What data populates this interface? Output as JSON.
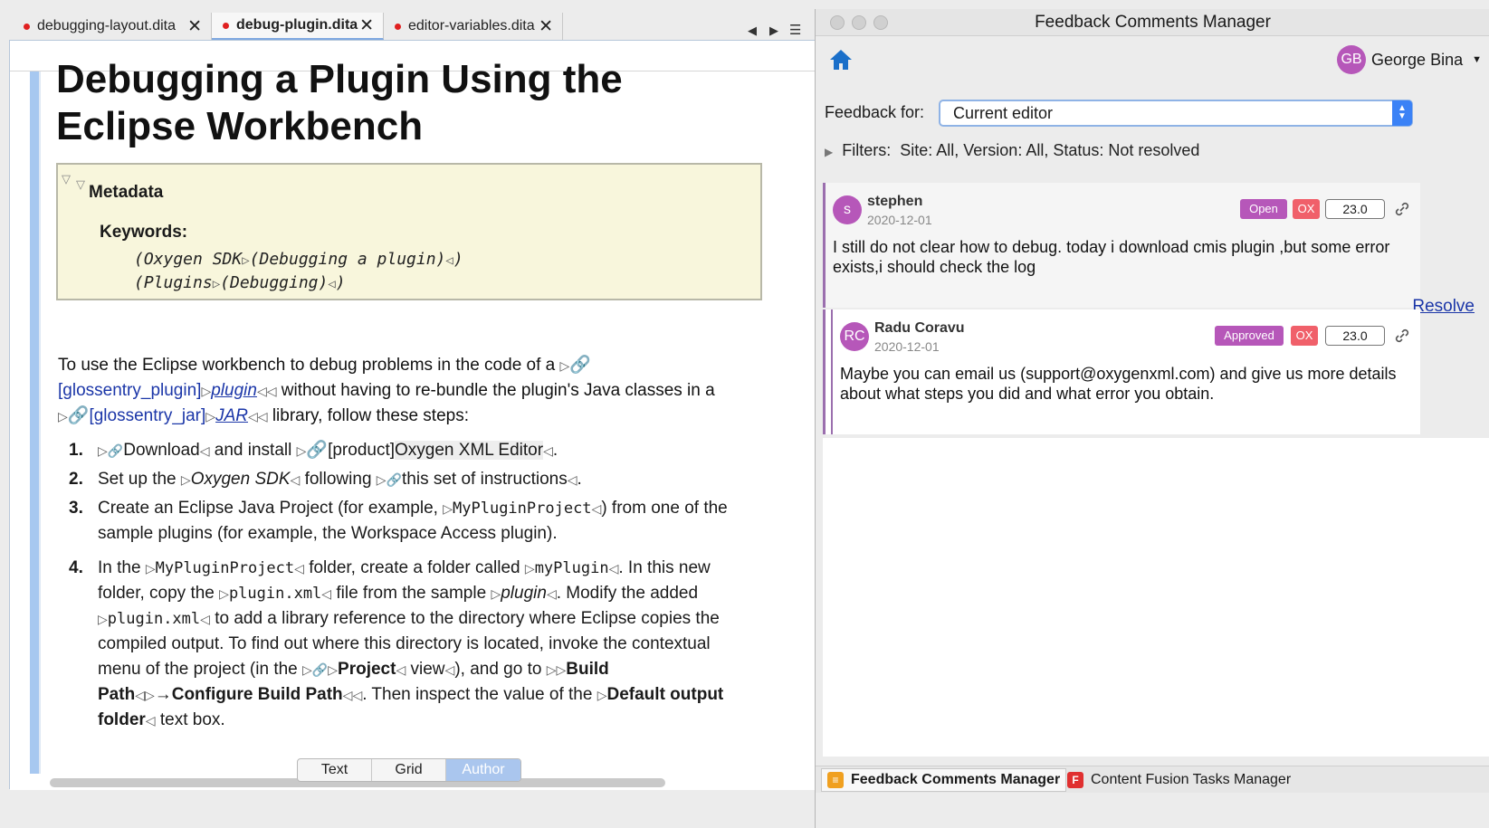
{
  "editor": {
    "tabs": [
      {
        "label": "debugging-layout.dita",
        "active": false
      },
      {
        "label": "debug-plugin.dita",
        "active": true
      },
      {
        "label": "editor-variables.dita",
        "active": false
      }
    ],
    "close_glyph": "✕",
    "title": "Debugging a Plugin Using the Eclipse Workbench",
    "metadata": {
      "heading": "Metadata",
      "keywords_heading": "Keywords:",
      "keywords": [
        {
          "primary": "(Oxygen SDK",
          "secondary": "(Debugging a plugin)",
          "close": ")"
        },
        {
          "primary": "(Plugins",
          "secondary": "(Debugging)",
          "close": ")"
        }
      ]
    },
    "intro": {
      "p1": "To use the Eclipse workbench to debug problems in the code of a",
      "ref1": "[glossentry_plugin]",
      "term1": "plugin",
      "p2": "without having to re-bundle the plugin's Java classes in a",
      "ref2": "[glossentry_jar]",
      "term2": "JAR",
      "p3": "library, follow these steps:"
    },
    "steps": [
      {
        "num": "1.",
        "link": "Download",
        "t1": "and install",
        "ref": "[product]",
        "t2": "Oxygen XML Editor",
        "t3": "."
      },
      {
        "num": "2.",
        "t1": "Set up the",
        "em": "Oxygen SDK",
        "t2": "following",
        "link": "this set of instructions",
        "t3": "."
      },
      {
        "num": "3.",
        "t1": "Create an Eclipse Java Project (for example,",
        "code": "MyPluginProject",
        "t2": ") from one of the sample plugins (for example, the Workspace Access plugin)."
      },
      {
        "num": "4.",
        "t1": "In the",
        "code1": "MyPluginProject",
        "t2": "folder, create a folder called",
        "code2": "myPlugin",
        "t3": ". In this new folder, copy the",
        "code3": "plugin.xml",
        "t4": "file from the sample",
        "em": "plugin",
        "t5": ". Modify the added",
        "code4": "plugin.xml",
        "t6": "to add a library reference to the directory where Eclipse copies the compiled output. To find out where this directory is located, invoke the contextual menu of the project (in the",
        "link1": "Project",
        "link2": "view",
        "t7": "), and go to",
        "b1": "Build Path",
        "arrow": "→",
        "b2": "Configure Build Path",
        "t8": ". Then inspect the value of the",
        "b3": "Default output folder",
        "t9": "text box."
      }
    ],
    "mode_tabs": [
      "Text",
      "Grid",
      "Author"
    ],
    "mode_selected": "Author"
  },
  "feedback": {
    "window_title": "Feedback Comments Manager",
    "user": {
      "initials": "GB",
      "name": "George Bina",
      "color": "#b657b9"
    },
    "feedback_for_label": "Feedback for:",
    "feedback_for_value": "Current editor",
    "filters_label": "Filters:",
    "filters_value": "Site: All, Version: All, Status: Not resolved",
    "comments": [
      {
        "initials": "s",
        "author": "stephen",
        "date": "2020-12-01",
        "status": "Open",
        "status_color": "#b657b9",
        "product": "OX",
        "product_color": "#f0606a",
        "version": "23.0",
        "text": "I still do not clear how to debug. today i download cmis plugin ,but some error exists,i  should check the log",
        "action": "Resolve",
        "avatar_color": "#b657b9"
      },
      {
        "initials": "RC",
        "author": "Radu Coravu",
        "date": "2020-12-01",
        "status": "Approved",
        "status_color": "#b657b9",
        "product": "OX",
        "product_color": "#f0606a",
        "version": "23.0",
        "text": "Maybe you can email us (support@oxygenxml.com) and give us more details about what steps you did and what error you obtain.",
        "avatar_color": "#b657b9"
      }
    ],
    "bottom_tabs": [
      {
        "label": "Feedback Comments Manager",
        "icon": "comment-icon",
        "selected": true
      },
      {
        "label": "Content Fusion Tasks Manager",
        "icon": "F",
        "selected": false
      }
    ],
    "accent": "#3b82f6"
  }
}
